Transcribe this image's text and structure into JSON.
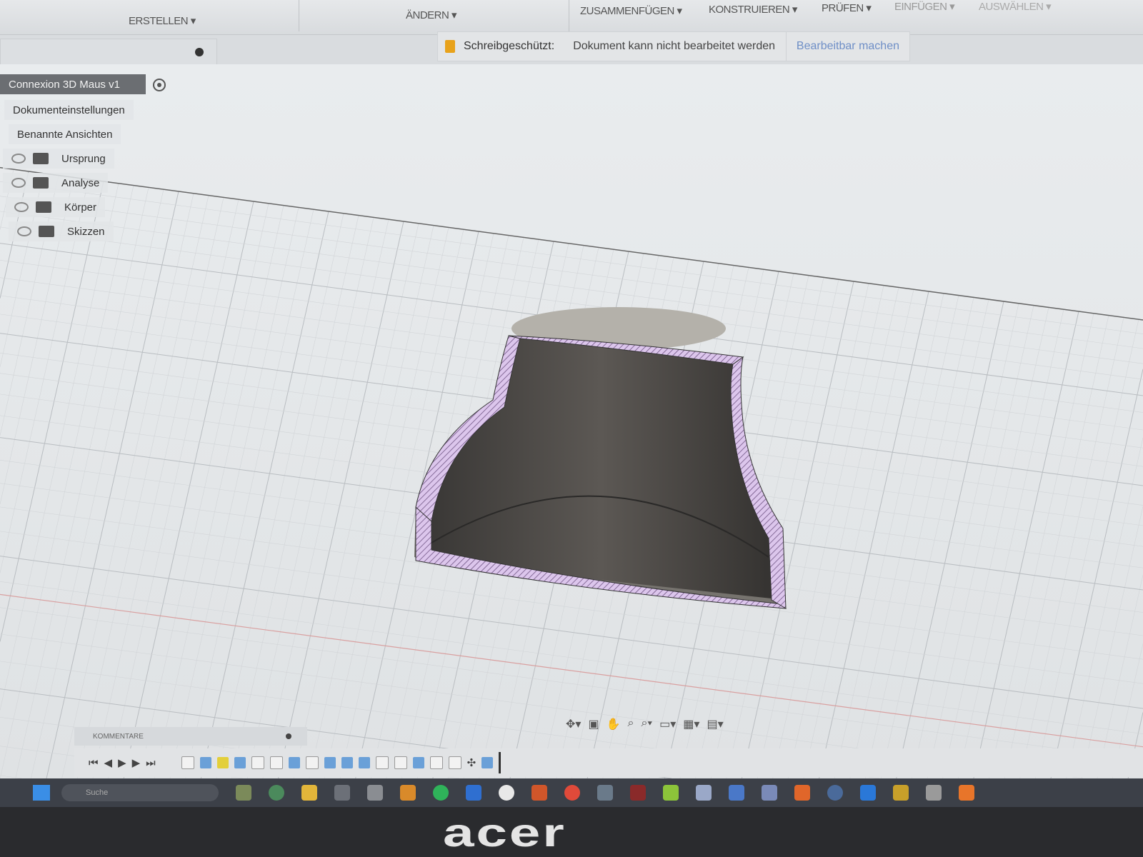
{
  "toolbar": {
    "groups": [
      "ERSTELLEN ▾",
      "ÄNDERN ▾",
      "ZUSAMMENFÜGEN ▾",
      "KONSTRUIEREN ▾",
      "PRÜFEN ▾",
      "EINFÜGEN ▾",
      "AUSWÄHLEN ▾"
    ]
  },
  "notice": {
    "title": "Schreibgeschützt:",
    "message": "Dokument kann nicht bearbeitet werden",
    "action": "Bearbeitbar machen"
  },
  "browser": {
    "root": "Connexion 3D Maus v1",
    "items": [
      "Dokumenteinstellungen",
      "Benannte Ansichten",
      "Ursprung",
      "Analyse",
      "Körper",
      "Skizzen"
    ]
  },
  "comments": {
    "label": "KOMMENTARE"
  },
  "navbar": {
    "icons": [
      "orbit-icon",
      "look-at-icon",
      "pan-icon",
      "zoom-icon",
      "fit-icon",
      "display-settings-icon",
      "grid-icon",
      "viewports-icon"
    ]
  },
  "timeline": {
    "controls": [
      "⏮",
      "◀",
      "▶",
      "▶",
      "⏭"
    ]
  },
  "taskbar": {
    "search_placeholder": "Suche"
  },
  "bezel": {
    "brand": "acer"
  },
  "colors": {
    "section_hatch": "#c9a9e0",
    "body": "#4a4744",
    "accent_link": "#6f8fc7",
    "lock": "#e8a21b"
  }
}
